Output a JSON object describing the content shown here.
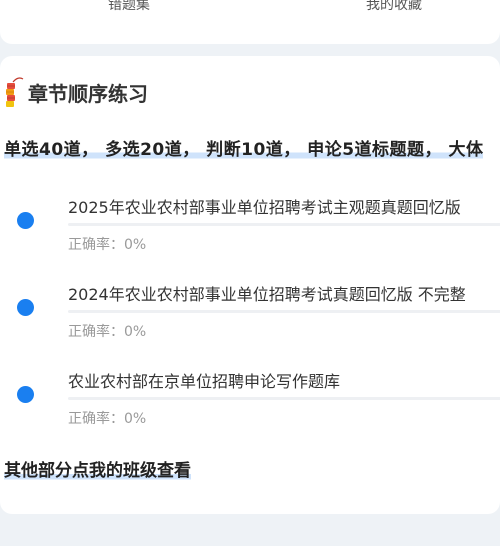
{
  "top_nav": {
    "left_label": "错题集",
    "right_label": "我的收藏"
  },
  "section": {
    "icon": "firecracker-icon",
    "title": "章节顺序练习",
    "subtitle": "单选40道， 多选20道， 判断10道， 申论5道标题题， 大体"
  },
  "items": [
    {
      "title": "2025年农业农村部事业单位招聘考试主观题真题回忆版",
      "rate": "正确率：0%"
    },
    {
      "title": "2024年农业农村部事业单位招聘考试真题回忆版 不完整",
      "rate": "正确率：0%"
    },
    {
      "title": "农业农村部在京单位招聘申论写作题库",
      "rate": "正确率：0%"
    }
  ],
  "footer_note": "其他部分点我的班级查看",
  "colors": {
    "accent": "#1a7ff0",
    "highlight": "#cfe3fb",
    "background": "#eef2f6"
  }
}
